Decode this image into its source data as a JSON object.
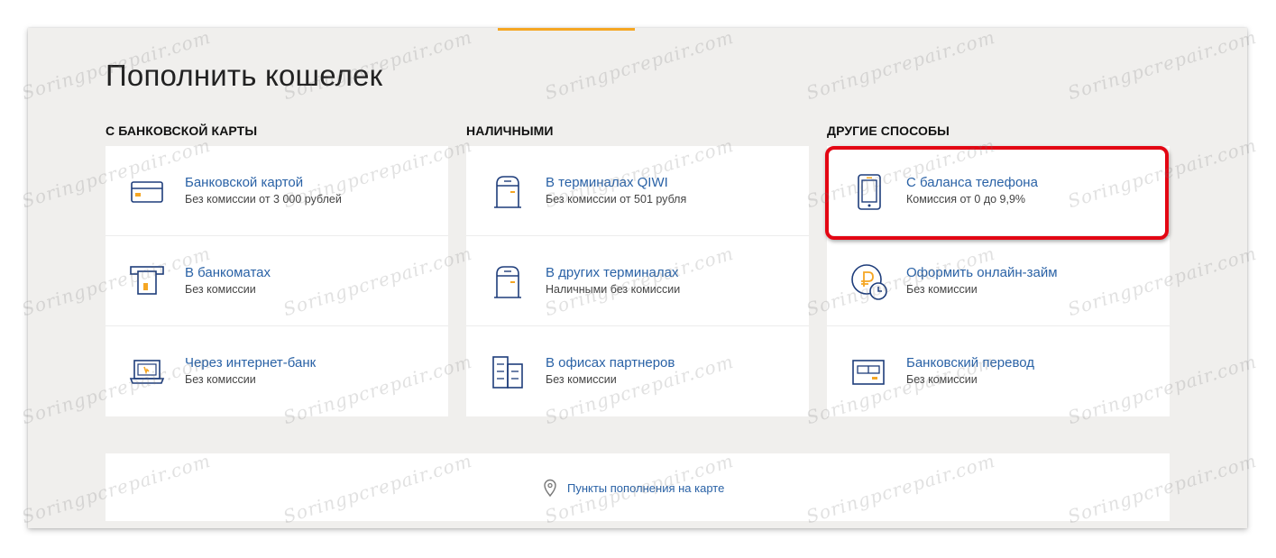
{
  "page": {
    "title": "Пополнить кошелек",
    "accent_color": "#f5a623",
    "link_color": "#2a62a6",
    "highlight_color": "#e30613"
  },
  "columns": [
    {
      "header": "С БАНКОВСКОЙ КАРТЫ",
      "items": [
        {
          "title": "Банковской картой",
          "subtitle": "Без комиссии от 3 000 рублей",
          "icon": "bank-card-icon"
        },
        {
          "title": "В банкоматах",
          "subtitle": "Без комиссии",
          "icon": "atm-icon"
        },
        {
          "title": "Через интернет-банк",
          "subtitle": "Без комиссии",
          "icon": "laptop-icon"
        }
      ]
    },
    {
      "header": "НАЛИЧНЫМИ",
      "items": [
        {
          "title": "В терминалах QIWI",
          "subtitle": "Без комиссии от 501 рубля",
          "icon": "terminal-icon"
        },
        {
          "title": "В других терминалах",
          "subtitle": "Наличными без комиссии",
          "icon": "terminal-icon"
        },
        {
          "title": "В офисах партнеров",
          "subtitle": "Без комиссии",
          "icon": "office-building-icon"
        }
      ]
    },
    {
      "header": "ДРУГИЕ СПОСОБЫ",
      "items": [
        {
          "title": "С баланса телефона",
          "subtitle": "Комиссия от 0 до 9,9%",
          "icon": "phone-icon"
        },
        {
          "title": "Оформить онлайн-займ",
          "subtitle": "Без комиссии",
          "icon": "ruble-coin-clock-icon"
        },
        {
          "title": "Банковский перевод",
          "subtitle": "Без комиссии",
          "icon": "bank-transfer-icon"
        }
      ]
    }
  ],
  "map": {
    "label": "Пункты пополнения на карте",
    "icon": "map-pin-icon"
  },
  "watermark": {
    "text": "Soringpcrepair.com"
  }
}
